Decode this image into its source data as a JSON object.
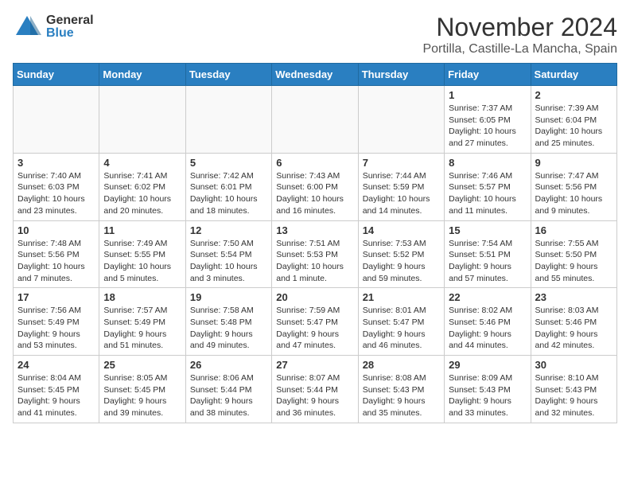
{
  "header": {
    "logo_general": "General",
    "logo_blue": "Blue",
    "month_title": "November 2024",
    "location": "Portilla, Castille-La Mancha, Spain"
  },
  "weekdays": [
    "Sunday",
    "Monday",
    "Tuesday",
    "Wednesday",
    "Thursday",
    "Friday",
    "Saturday"
  ],
  "weeks": [
    [
      {
        "day": "",
        "info": ""
      },
      {
        "day": "",
        "info": ""
      },
      {
        "day": "",
        "info": ""
      },
      {
        "day": "",
        "info": ""
      },
      {
        "day": "",
        "info": ""
      },
      {
        "day": "1",
        "info": "Sunrise: 7:37 AM\nSunset: 6:05 PM\nDaylight: 10 hours and 27 minutes."
      },
      {
        "day": "2",
        "info": "Sunrise: 7:39 AM\nSunset: 6:04 PM\nDaylight: 10 hours and 25 minutes."
      }
    ],
    [
      {
        "day": "3",
        "info": "Sunrise: 7:40 AM\nSunset: 6:03 PM\nDaylight: 10 hours and 23 minutes."
      },
      {
        "day": "4",
        "info": "Sunrise: 7:41 AM\nSunset: 6:02 PM\nDaylight: 10 hours and 20 minutes."
      },
      {
        "day": "5",
        "info": "Sunrise: 7:42 AM\nSunset: 6:01 PM\nDaylight: 10 hours and 18 minutes."
      },
      {
        "day": "6",
        "info": "Sunrise: 7:43 AM\nSunset: 6:00 PM\nDaylight: 10 hours and 16 minutes."
      },
      {
        "day": "7",
        "info": "Sunrise: 7:44 AM\nSunset: 5:59 PM\nDaylight: 10 hours and 14 minutes."
      },
      {
        "day": "8",
        "info": "Sunrise: 7:46 AM\nSunset: 5:57 PM\nDaylight: 10 hours and 11 minutes."
      },
      {
        "day": "9",
        "info": "Sunrise: 7:47 AM\nSunset: 5:56 PM\nDaylight: 10 hours and 9 minutes."
      }
    ],
    [
      {
        "day": "10",
        "info": "Sunrise: 7:48 AM\nSunset: 5:56 PM\nDaylight: 10 hours and 7 minutes."
      },
      {
        "day": "11",
        "info": "Sunrise: 7:49 AM\nSunset: 5:55 PM\nDaylight: 10 hours and 5 minutes."
      },
      {
        "day": "12",
        "info": "Sunrise: 7:50 AM\nSunset: 5:54 PM\nDaylight: 10 hours and 3 minutes."
      },
      {
        "day": "13",
        "info": "Sunrise: 7:51 AM\nSunset: 5:53 PM\nDaylight: 10 hours and 1 minute."
      },
      {
        "day": "14",
        "info": "Sunrise: 7:53 AM\nSunset: 5:52 PM\nDaylight: 9 hours and 59 minutes."
      },
      {
        "day": "15",
        "info": "Sunrise: 7:54 AM\nSunset: 5:51 PM\nDaylight: 9 hours and 57 minutes."
      },
      {
        "day": "16",
        "info": "Sunrise: 7:55 AM\nSunset: 5:50 PM\nDaylight: 9 hours and 55 minutes."
      }
    ],
    [
      {
        "day": "17",
        "info": "Sunrise: 7:56 AM\nSunset: 5:49 PM\nDaylight: 9 hours and 53 minutes."
      },
      {
        "day": "18",
        "info": "Sunrise: 7:57 AM\nSunset: 5:49 PM\nDaylight: 9 hours and 51 minutes."
      },
      {
        "day": "19",
        "info": "Sunrise: 7:58 AM\nSunset: 5:48 PM\nDaylight: 9 hours and 49 minutes."
      },
      {
        "day": "20",
        "info": "Sunrise: 7:59 AM\nSunset: 5:47 PM\nDaylight: 9 hours and 47 minutes."
      },
      {
        "day": "21",
        "info": "Sunrise: 8:01 AM\nSunset: 5:47 PM\nDaylight: 9 hours and 46 minutes."
      },
      {
        "day": "22",
        "info": "Sunrise: 8:02 AM\nSunset: 5:46 PM\nDaylight: 9 hours and 44 minutes."
      },
      {
        "day": "23",
        "info": "Sunrise: 8:03 AM\nSunset: 5:46 PM\nDaylight: 9 hours and 42 minutes."
      }
    ],
    [
      {
        "day": "24",
        "info": "Sunrise: 8:04 AM\nSunset: 5:45 PM\nDaylight: 9 hours and 41 minutes."
      },
      {
        "day": "25",
        "info": "Sunrise: 8:05 AM\nSunset: 5:45 PM\nDaylight: 9 hours and 39 minutes."
      },
      {
        "day": "26",
        "info": "Sunrise: 8:06 AM\nSunset: 5:44 PM\nDaylight: 9 hours and 38 minutes."
      },
      {
        "day": "27",
        "info": "Sunrise: 8:07 AM\nSunset: 5:44 PM\nDaylight: 9 hours and 36 minutes."
      },
      {
        "day": "28",
        "info": "Sunrise: 8:08 AM\nSunset: 5:43 PM\nDaylight: 9 hours and 35 minutes."
      },
      {
        "day": "29",
        "info": "Sunrise: 8:09 AM\nSunset: 5:43 PM\nDaylight: 9 hours and 33 minutes."
      },
      {
        "day": "30",
        "info": "Sunrise: 8:10 AM\nSunset: 5:43 PM\nDaylight: 9 hours and 32 minutes."
      }
    ]
  ]
}
